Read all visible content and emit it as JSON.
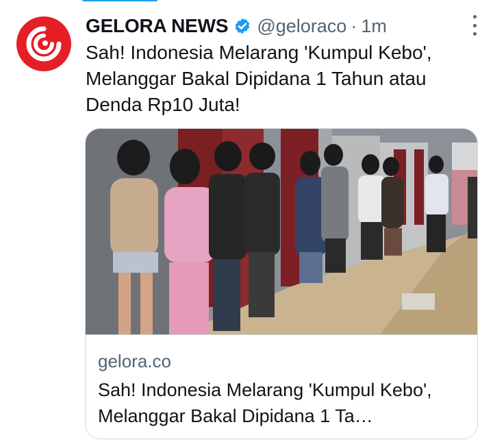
{
  "tweet": {
    "author_name": "GELORA NEWS",
    "author_handle": "@geloraco",
    "separator": "·",
    "time": "1m",
    "verified": true,
    "text": "Sah! Indonesia Melarang 'Kumpul Kebo', Melanggar Bakal Dipidana 1 Tahun atau Denda Rp10 Juta!"
  },
  "card": {
    "domain": "gelora.co",
    "title": "Sah! Indonesia Melarang 'Kumpul Kebo', Melanggar Bakal Dipidana 1 Ta…",
    "image_alt_subject": "row of young people standing against a wall"
  },
  "icons": {
    "avatar": "gelora-logo-icon",
    "verified": "verified-badge-icon",
    "more": "more-options-icon"
  },
  "colors": {
    "brand_red": "#e51f25",
    "verified_blue": "#1d9bf0",
    "text_primary": "#0f1419",
    "text_secondary": "#536471",
    "border": "#cfd9de"
  }
}
